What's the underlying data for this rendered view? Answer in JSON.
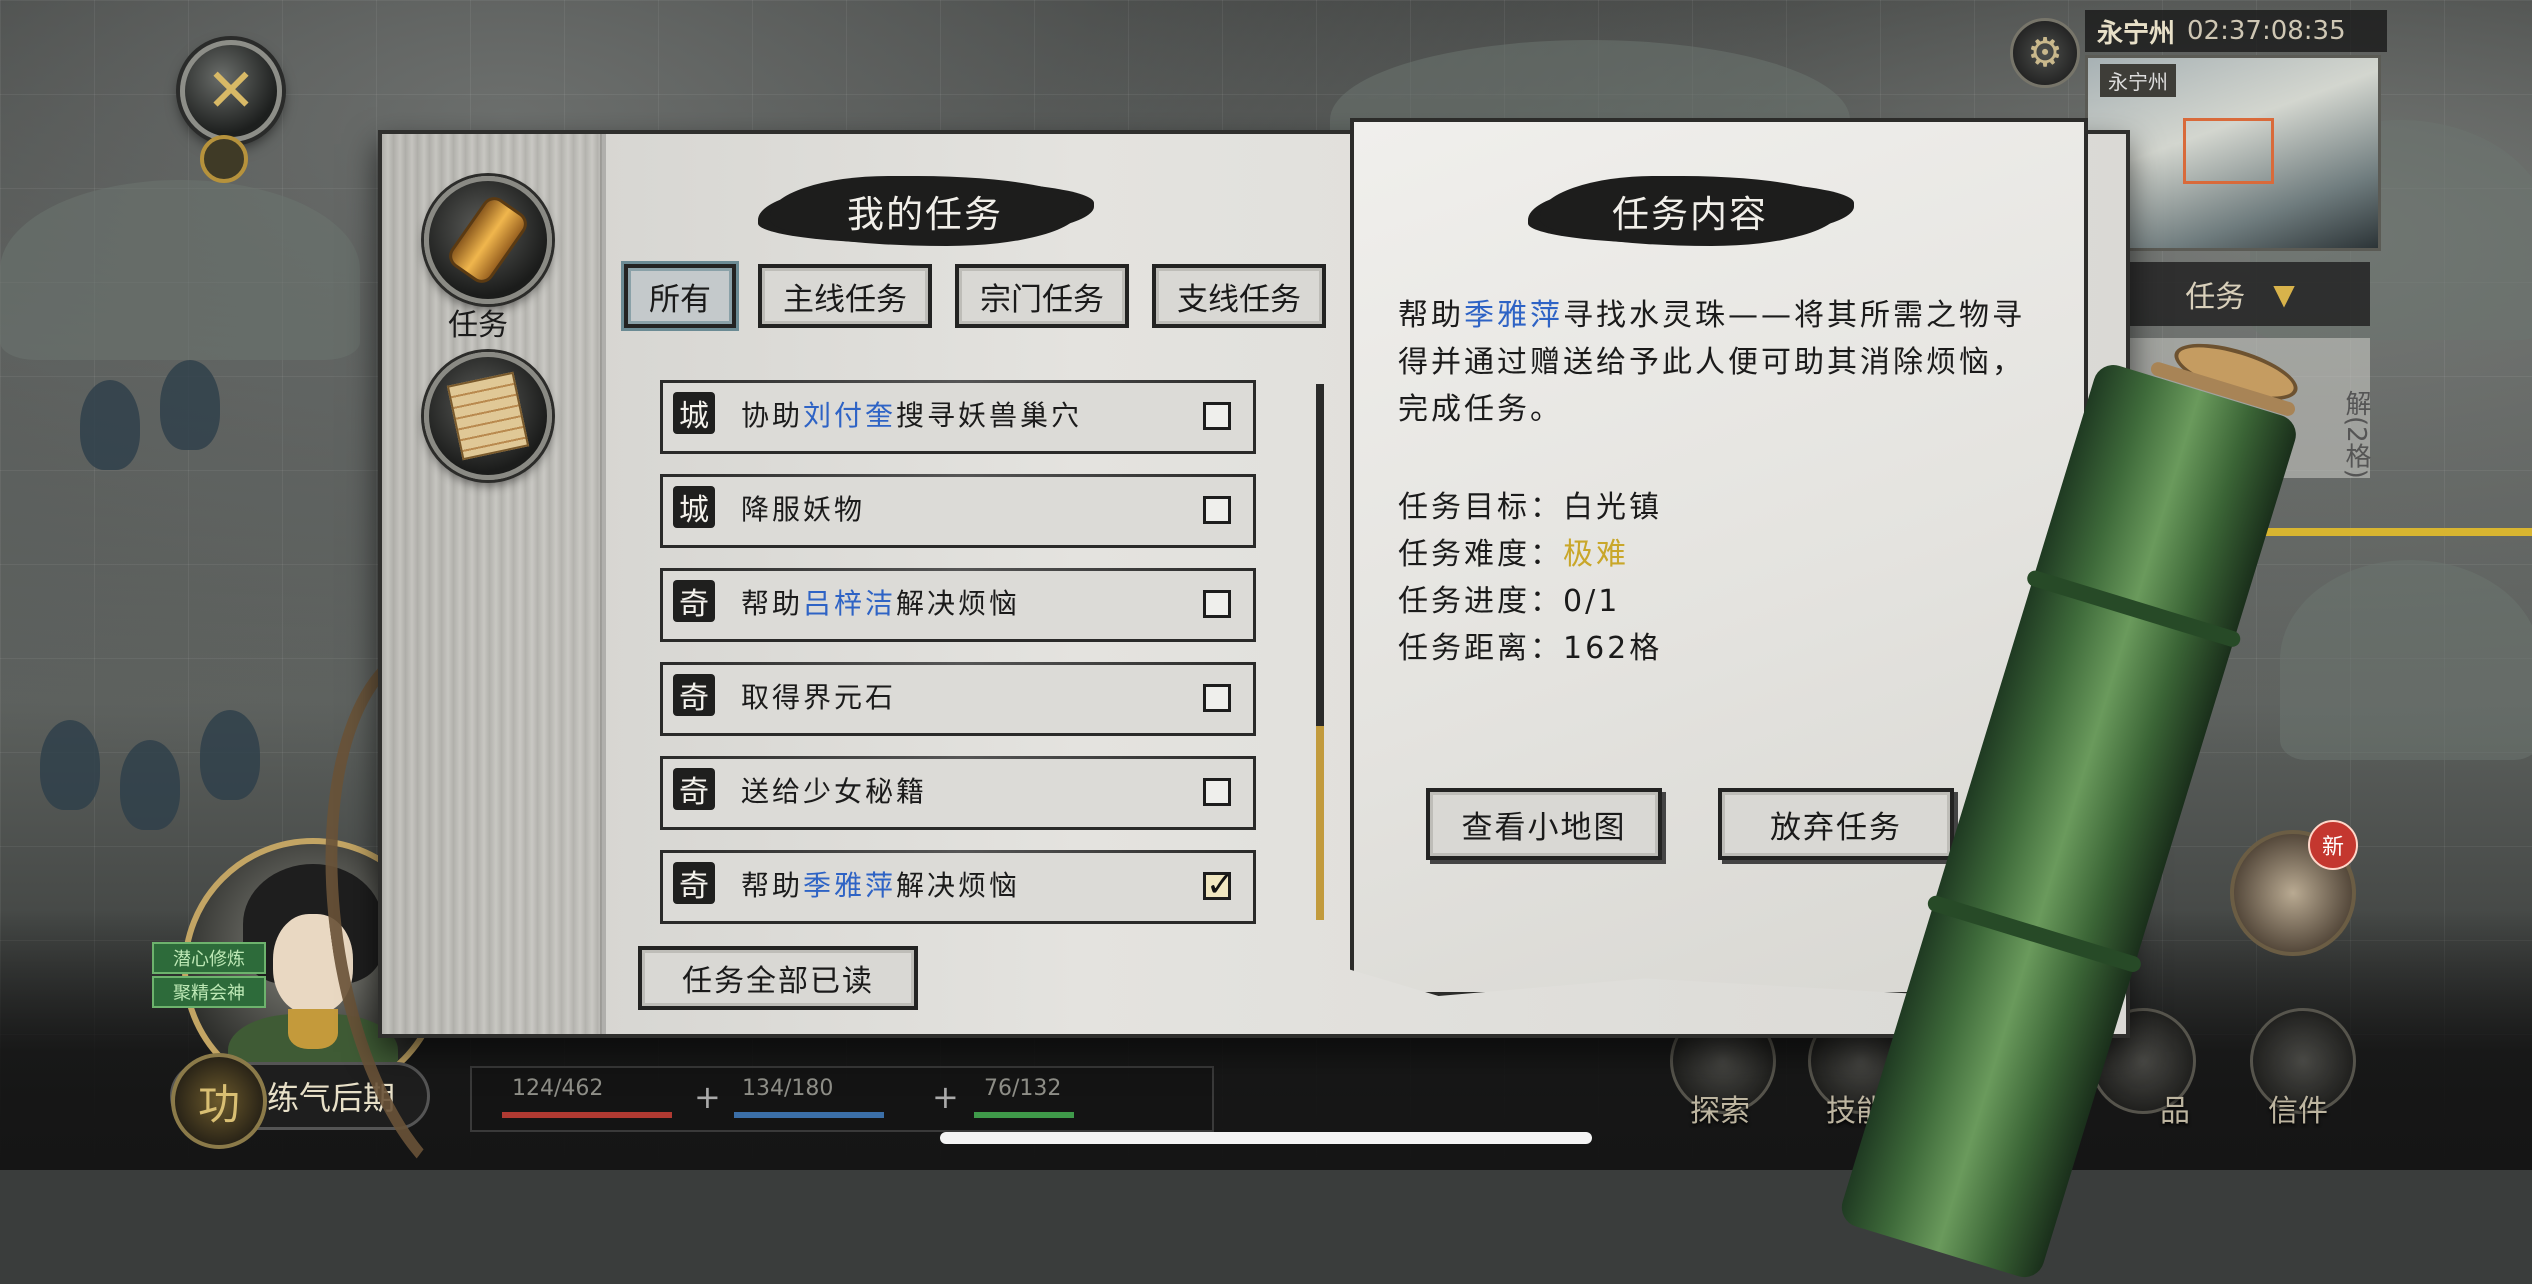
{
  "hud": {
    "close_glyph": "✕",
    "time_location": "永宁州",
    "time_value": "02:37:08:35",
    "minimap_tag": "永宁州",
    "right_dropdown": "任务",
    "right_dropdown_caret": "▼",
    "right_card_text": "解(2格)",
    "settings_glyph": "⚙"
  },
  "player": {
    "tags": [
      "潜心修炼",
      "聚精会神"
    ],
    "rank_emblem": "功",
    "rank": "练气后期",
    "stats": [
      {
        "label": "124/462",
        "color": "#b03a32"
      },
      {
        "label": "134/180",
        "color": "#3b6fa8"
      },
      {
        "label": "76/132",
        "color": "#3f9a4a"
      }
    ],
    "plus_glyph": "+"
  },
  "bottom_menu": [
    {
      "label": "探索"
    },
    {
      "label": "技能"
    },
    {
      "label": "技"
    },
    {
      "label": "品"
    },
    {
      "label": "信件"
    }
  ],
  "new_badge": "新",
  "book": {
    "side_tab_label": "任务",
    "list_title": "我的任务",
    "filters": [
      {
        "label": "所有",
        "active": true
      },
      {
        "label": "主线任务",
        "active": false
      },
      {
        "label": "宗门任务",
        "active": false
      },
      {
        "label": "支线任务",
        "active": false
      }
    ],
    "quests": [
      {
        "type": "城",
        "prefix": "协助",
        "name": "刘付奎",
        "suffix": "搜寻妖兽巢穴",
        "checked": false
      },
      {
        "type": "城",
        "prefix": "降服妖物",
        "name": "",
        "suffix": "",
        "checked": false
      },
      {
        "type": "奇",
        "prefix": "帮助",
        "name": "吕梓洁",
        "suffix": "解决烦恼",
        "checked": false
      },
      {
        "type": "奇",
        "prefix": "取得界元石",
        "name": "",
        "suffix": "",
        "checked": false
      },
      {
        "type": "奇",
        "prefix": "送给少女秘籍",
        "name": "",
        "suffix": "",
        "checked": false
      },
      {
        "type": "奇",
        "prefix": "帮助",
        "name": "季雅萍",
        "suffix": "解决烦恼",
        "checked": true
      }
    ],
    "mark_all_read": "任务全部已读",
    "detail_title": "任务内容",
    "detail_desc_prefix": "帮助",
    "detail_desc_name": "季雅萍",
    "detail_desc_suffix": "寻找水灵珠——将其所需之物寻得并通过赠送给予此人便可助其消除烦恼，完成任务。",
    "details": [
      {
        "label": "任务目标：",
        "value": "白光镇",
        "hard": false
      },
      {
        "label": "任务难度：",
        "value": "极难",
        "hard": true
      },
      {
        "label": "任务进度：",
        "value": "0/1",
        "hard": false
      },
      {
        "label": "任务距离：",
        "value": "162格",
        "hard": false
      }
    ],
    "btn_minimap": "查看小地图",
    "btn_abandon": "放弃任务"
  }
}
